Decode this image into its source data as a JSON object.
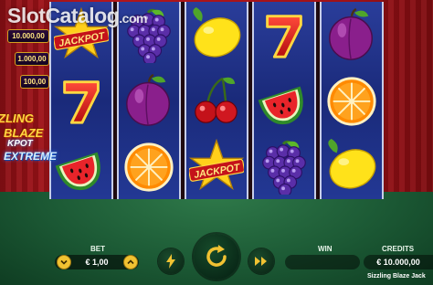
{
  "watermark": {
    "brand": "SlotCatalog",
    "suffix": ".com"
  },
  "jackpots": [
    "10.000,00",
    "1.000,00",
    "100,00"
  ],
  "logo": {
    "line1": "ZLING",
    "line2": "BLAZE",
    "line3": "KPOT",
    "line4": "EXTREME"
  },
  "reels": [
    [
      "jackpot",
      "seven",
      "watermelon"
    ],
    [
      "grapes",
      "plum",
      "orange"
    ],
    [
      "lemon",
      "cherries",
      "jackpot"
    ],
    [
      "seven",
      "watermelon",
      "grapes"
    ],
    [
      "plum",
      "orange",
      "lemon"
    ]
  ],
  "jackpot_symbol_text": "JACKPOT",
  "controls": {
    "bet_label": "BET",
    "bet_value": "€ 1,00",
    "bet_minus_icon": "minus-icon",
    "bet_plus_icon": "plus-icon",
    "turbo_icon": "lightning-icon",
    "spin_icon": "spin-arrow-icon",
    "autoplay_icon": "fast-forward-icon",
    "win_label": "WIN",
    "win_value": "",
    "credits_label": "CREDITS",
    "credits_value": "€ 10.000,00"
  },
  "game_title": "Sizzling Blaze Jack",
  "colors": {
    "reel_blue": "#1a2a7a",
    "accent_gold": "#f1c232",
    "felt_green": "#1c5a35",
    "background_red": "#b3161c"
  }
}
